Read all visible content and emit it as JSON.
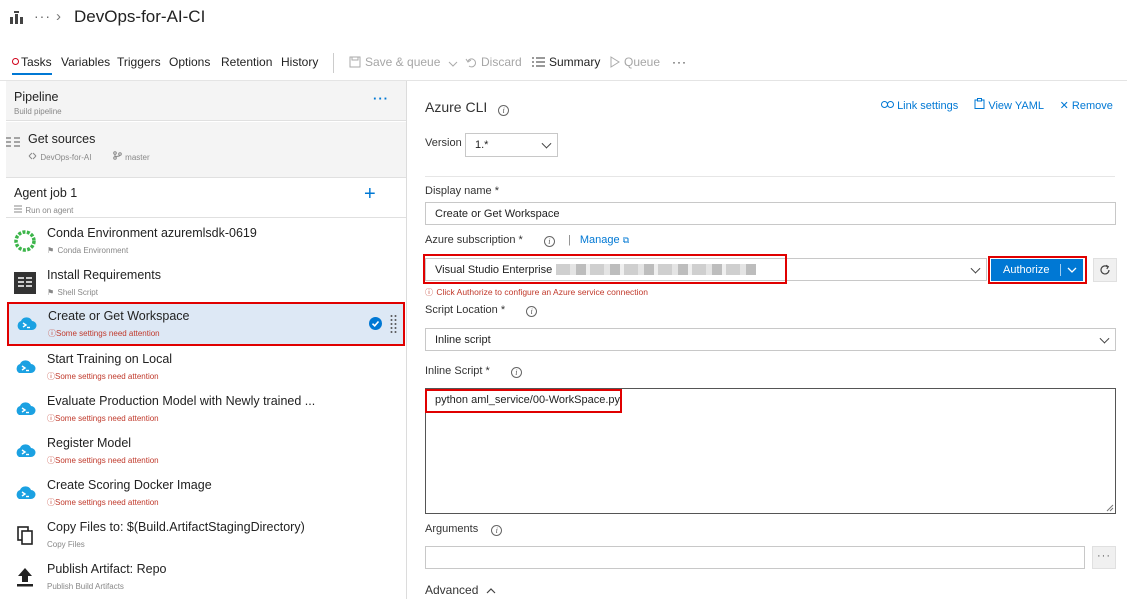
{
  "breadcrumb": {
    "more": "···",
    "separator": "›",
    "title": "DevOps-for-AI-CI"
  },
  "tabs": [
    {
      "label": "Tasks",
      "active": true
    },
    {
      "label": "Variables"
    },
    {
      "label": "Triggers"
    },
    {
      "label": "Options"
    },
    {
      "label": "Retention"
    },
    {
      "label": "History"
    }
  ],
  "toolbar": {
    "save_queue": "Save & queue",
    "discard": "Discard",
    "summary": "Summary",
    "queue": "Queue",
    "more": "···"
  },
  "pipeline": {
    "title": "Pipeline",
    "subtitle": "Build pipeline",
    "more": "···"
  },
  "get_sources": {
    "title": "Get sources",
    "repo": "DevOps-for-AI",
    "branch": "master"
  },
  "agent_job": {
    "title": "Agent job 1",
    "subtitle": "Run on agent",
    "add": "+"
  },
  "tasks": [
    {
      "name": "Conda Environment azuremlsdk-0619",
      "sub": "Conda Environment",
      "icon": "conda-icon",
      "warn": false
    },
    {
      "name": "Install Requirements",
      "sub": "Shell Script",
      "icon": "shell-script-icon",
      "warn": false
    },
    {
      "name": "Create or Get Workspace",
      "sub": "Some settings need attention",
      "icon": "azure-cli-icon",
      "warn": true,
      "selected": true
    },
    {
      "name": "Start Training on Local",
      "sub": "Some settings need attention",
      "icon": "azure-cli-icon",
      "warn": true
    },
    {
      "name": "Evaluate Production Model with Newly trained ...",
      "sub": "Some settings need attention",
      "icon": "azure-cli-icon",
      "warn": true
    },
    {
      "name": "Register Model",
      "sub": "Some settings need attention",
      "icon": "azure-cli-icon",
      "warn": true
    },
    {
      "name": "Create Scoring Docker Image",
      "sub": "Some settings need attention",
      "icon": "azure-cli-icon",
      "warn": true
    },
    {
      "name": "Copy Files to: $(Build.ArtifactStagingDirectory)",
      "sub": "Copy Files",
      "icon": "copy-files-icon",
      "warn": false
    },
    {
      "name": "Publish Artifact: Repo",
      "sub": "Publish Build Artifacts",
      "icon": "publish-artifact-icon",
      "warn": false
    }
  ],
  "detail": {
    "title": "Azure CLI",
    "link_settings": "Link settings",
    "view_yaml": "View YAML",
    "remove": "Remove",
    "version_label": "Version",
    "version_value": "1.*",
    "display_name_label": "Display name *",
    "display_name_value": "Create or Get Workspace",
    "subscription_label": "Azure subscription *",
    "manage": "Manage",
    "subscription_value": "Visual Studio Enterprise",
    "authorize": "Authorize",
    "authorize_hint": "Click Authorize to configure an Azure service connection",
    "script_location_label": "Script Location *",
    "script_location_value": "Inline script",
    "inline_script_label": "Inline Script *",
    "inline_script_value": "python aml_service/00-WorkSpace.py",
    "arguments_label": "Arguments",
    "arguments_more": "···",
    "advanced": "Advanced"
  },
  "colors": {
    "accent": "#0078d4",
    "highlight_red": "#e00000",
    "warning": "#c0392b",
    "selected_bg": "#dde8f5"
  }
}
